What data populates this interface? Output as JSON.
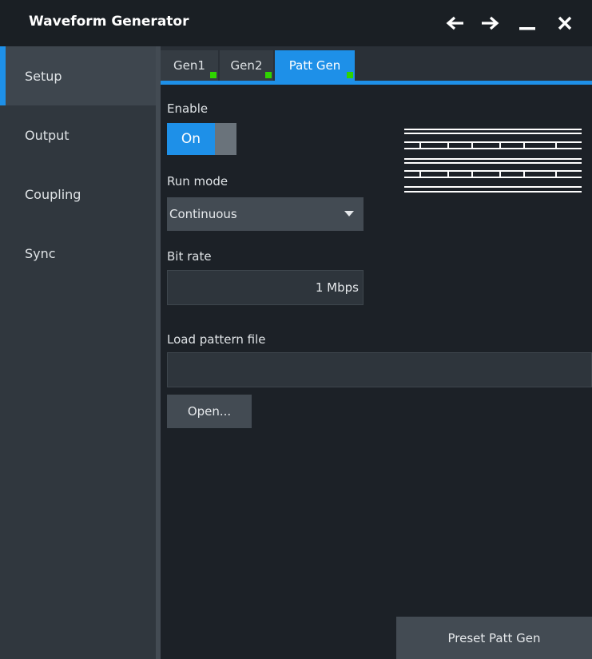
{
  "window": {
    "title": "Waveform Generator",
    "icons": {
      "back": "arrow-left-icon",
      "forward": "arrow-right-icon",
      "minimize": "minimize-icon",
      "close": "close-icon"
    }
  },
  "sidebar": {
    "items": [
      {
        "label": "Setup",
        "active": true
      },
      {
        "label": "Output",
        "active": false
      },
      {
        "label": "Coupling",
        "active": false
      },
      {
        "label": "Sync",
        "active": false
      }
    ]
  },
  "tabs": [
    {
      "label": "Gen1",
      "active": false,
      "status": "green"
    },
    {
      "label": "Gen2",
      "active": false,
      "status": "green"
    },
    {
      "label": "Patt Gen",
      "active": true,
      "status": "green"
    }
  ],
  "setup": {
    "enable_label": "Enable",
    "enable_value": "On",
    "run_mode_label": "Run mode",
    "run_mode_value": "Continuous",
    "bit_rate_label": "Bit rate",
    "bit_rate_value": "1 Mbps",
    "load_pattern_label": "Load pattern file",
    "pattern_file_value": "",
    "open_button": "Open...",
    "preset_button": "Preset Patt Gen"
  },
  "colors": {
    "accent": "#1e90e8",
    "status_green": "#2fd400",
    "background": "#1c2127",
    "sidebar": "#30373e"
  }
}
